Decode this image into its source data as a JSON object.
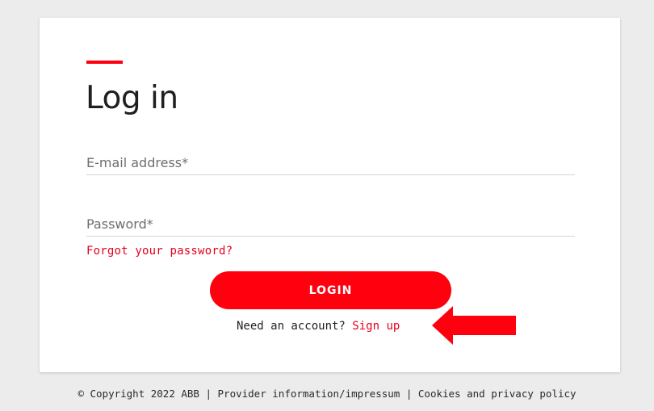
{
  "login": {
    "title": "Log in",
    "email_placeholder": "E-mail address*",
    "password_placeholder": "Password*",
    "forgot_password": "Forgot your password?",
    "login_button": "LOGIN",
    "need_account": "Need an account? ",
    "sign_up": "Sign up"
  },
  "footer": {
    "copyright": "© Copyright 2022 ABB",
    "separator": " | ",
    "provider_link": "Provider information/impressum",
    "cookies_link": "Cookies and privacy policy"
  },
  "colors": {
    "brand_red": "#ff000f",
    "background": "#ececec",
    "card": "#ffffff"
  },
  "icons": {
    "annotation": "red-arrow-left-icon"
  }
}
